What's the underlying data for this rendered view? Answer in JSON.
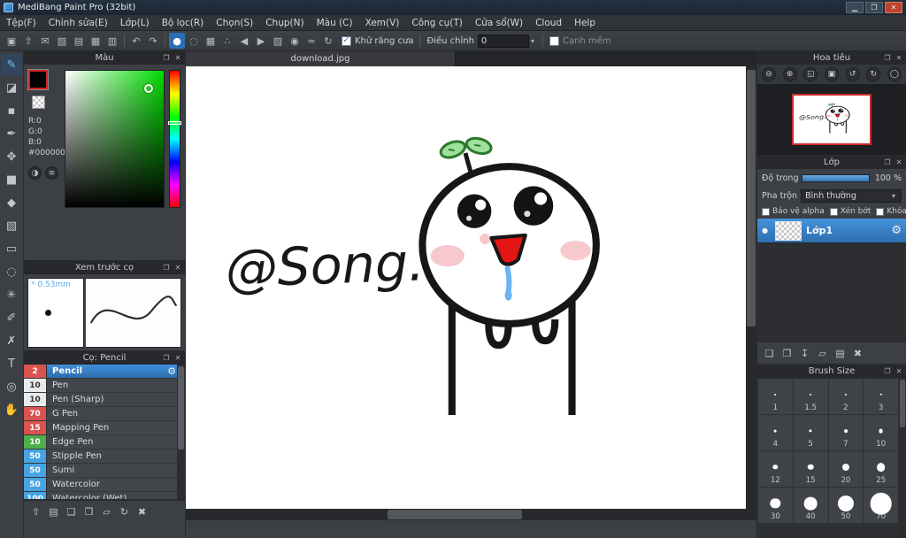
{
  "window": {
    "title": "MediBang Paint Pro (32bit)"
  },
  "icons": {
    "minimize": "▁",
    "maximize": "❒",
    "close": "✕",
    "float": "❐",
    "gear": "⚙",
    "dropdown": "▾",
    "check": "✓",
    "visibility_dot": "●",
    "color_wheel": "◑",
    "color_sliders": "≡"
  },
  "menu": {
    "items": [
      "Tệp(F)",
      "Chỉnh sửa(E)",
      "Lớp(L)",
      "Bộ lọc(R)",
      "Chọn(S)",
      "Chụp(N)",
      "Màu (C)",
      "Xem(V)",
      "Công cụ(T)",
      "Cửa sổ(W)",
      "Cloud",
      "Help"
    ]
  },
  "toolbar": {
    "file_icons": [
      {
        "name": "save",
        "glyph": "▣"
      },
      {
        "name": "upload",
        "glyph": "⇧"
      },
      {
        "name": "comment",
        "glyph": "✉"
      },
      {
        "name": "image",
        "glyph": "▨"
      },
      {
        "name": "document",
        "glyph": "▤"
      },
      {
        "name": "grid-view",
        "glyph": "▦"
      },
      {
        "name": "layout",
        "glyph": "▥"
      }
    ],
    "history_icons": [
      {
        "name": "undo",
        "glyph": "↶"
      },
      {
        "name": "redo",
        "glyph": "↷"
      }
    ],
    "brush_icons": [
      {
        "name": "round-brush",
        "glyph": "●",
        "selected": true
      },
      {
        "name": "soft-brush",
        "glyph": "◌"
      },
      {
        "name": "grid-brush",
        "glyph": "▦"
      },
      {
        "name": "scatter-brush",
        "glyph": "∴"
      },
      {
        "name": "prev-brush",
        "glyph": "◀"
      },
      {
        "name": "next-brush",
        "glyph": "▶"
      },
      {
        "name": "hatch-brush",
        "glyph": "▨"
      },
      {
        "name": "target-brush",
        "glyph": "◉"
      },
      {
        "name": "wave-brush",
        "glyph": "≈"
      },
      {
        "name": "rotate-brush",
        "glyph": "↻"
      }
    ],
    "antialias_label": "Khử răng cưa",
    "adjust_label": "Điều chỉnh",
    "adjust_value": "0",
    "soft_edge_label": "Cạnh mềm"
  },
  "tools": [
    {
      "name": "brush",
      "glyph": "✎",
      "selected": true
    },
    {
      "name": "eraser",
      "glyph": "◪"
    },
    {
      "name": "dot",
      "glyph": "▪"
    },
    {
      "name": "finger",
      "glyph": "✒"
    },
    {
      "name": "move",
      "glyph": "✥"
    },
    {
      "name": "fill-shape",
      "glyph": "■"
    },
    {
      "name": "bucket",
      "glyph": "◆"
    },
    {
      "name": "gradient",
      "glyph": "▧"
    },
    {
      "name": "select",
      "glyph": "▭"
    },
    {
      "name": "lasso",
      "glyph": "◌"
    },
    {
      "name": "magic-wand",
      "glyph": "✳"
    },
    {
      "name": "select-pen",
      "glyph": "✐"
    },
    {
      "name": "select-eraser",
      "glyph": "✗"
    },
    {
      "name": "text",
      "glyph": "T"
    },
    {
      "name": "eyedropper",
      "glyph": "◎"
    },
    {
      "name": "hand",
      "glyph": "✋"
    }
  ],
  "color_panel": {
    "title": "Màu",
    "r_label": "R:0",
    "g_label": "G:0",
    "b_label": "B:0",
    "hex": "#000000"
  },
  "brush_preview_panel": {
    "title": "Xem trước cọ",
    "size_label": "* 0.53mm"
  },
  "brush_panel": {
    "title": "Cọ: Pencil",
    "brushes": [
      {
        "size": "2",
        "name": "Pencil",
        "swatch": "#d9534f",
        "selected": true
      },
      {
        "size": "10",
        "name": "Pen",
        "swatch": "#e9eaec"
      },
      {
        "size": "10",
        "name": "Pen (Sharp)",
        "swatch": "#e9eaec"
      },
      {
        "size": "70",
        "name": "G Pen",
        "swatch": "#d9534f"
      },
      {
        "size": "15",
        "name": "Mapping Pen",
        "swatch": "#d9534f"
      },
      {
        "size": "10",
        "name": "Edge Pen",
        "swatch": "#4cae4c"
      },
      {
        "size": "50",
        "name": "Stipple Pen",
        "swatch": "#47a3e3"
      },
      {
        "size": "50",
        "name": "Sumi",
        "swatch": "#47a3e3"
      },
      {
        "size": "50",
        "name": "Watercolor",
        "swatch": "#47a3e3"
      },
      {
        "size": "100",
        "name": "Watercolor (Wet)",
        "swatch": "#47a3e3"
      }
    ],
    "action_icons": [
      {
        "name": "upload-brush",
        "glyph": "⇧"
      },
      {
        "name": "brush-menu",
        "glyph": "▤"
      },
      {
        "name": "add-brush",
        "glyph": "❏"
      },
      {
        "name": "duplicate-brush",
        "glyph": "❐"
      },
      {
        "name": "brush-folder",
        "glyph": "▱"
      },
      {
        "name": "sync-brushes",
        "glyph": "↻"
      },
      {
        "name": "delete-brush",
        "glyph": "✖"
      }
    ]
  },
  "canvas": {
    "tab_title": "download.jpg",
    "drawing_text": "@Song."
  },
  "navigator_panel": {
    "title": "Hoa tiêu",
    "buttons": [
      {
        "name": "zoom-out",
        "glyph": "⊖"
      },
      {
        "name": "zoom-in",
        "glyph": "⊕"
      },
      {
        "name": "fit-window",
        "glyph": "◱"
      },
      {
        "name": "actual-size",
        "glyph": "▣"
      },
      {
        "name": "rotate-left",
        "glyph": "↺"
      },
      {
        "name": "rotate-right",
        "glyph": "↻"
      },
      {
        "name": "reset-view",
        "glyph": "◯"
      }
    ]
  },
  "layer_panel": {
    "title": "Lớp",
    "opacity_label": "Độ trong",
    "opacity_value": "100 %",
    "opacity_percent": 100,
    "blend_label": "Pha trộn",
    "blend_value": "Bình thường",
    "checkboxes": [
      {
        "label": "Bảo vệ alpha",
        "checked": false
      },
      {
        "label": "Xén bớt",
        "checked": false
      },
      {
        "label": "Khóa",
        "checked": false
      }
    ],
    "layers": [
      {
        "name": "Lớp1",
        "selected": true
      }
    ],
    "action_icons": [
      {
        "name": "add-layer",
        "glyph": "❏"
      },
      {
        "name": "duplicate-layer",
        "glyph": "❐"
      },
      {
        "name": "merge-layer",
        "glyph": "↧"
      },
      {
        "name": "layer-folder",
        "glyph": "▱"
      },
      {
        "name": "layer-material",
        "glyph": "▤"
      },
      {
        "name": "delete-layer",
        "glyph": "✖"
      }
    ]
  },
  "brush_size_panel": {
    "title": "Brush Size",
    "sizes": [
      "1",
      "1.5",
      "2",
      "3",
      "4",
      "5",
      "7",
      "10",
      "12",
      "15",
      "20",
      "25",
      "30",
      "40",
      "50",
      "70"
    ]
  },
  "colors": {
    "accent_blue": "#3d8bd4",
    "selection_blue": "#2f6fae",
    "thumbnail_border_red": "#cc2a2a",
    "foreground_color": "#000000",
    "hue_selected": "#00dc00",
    "close_button_red": "#c0432e"
  }
}
